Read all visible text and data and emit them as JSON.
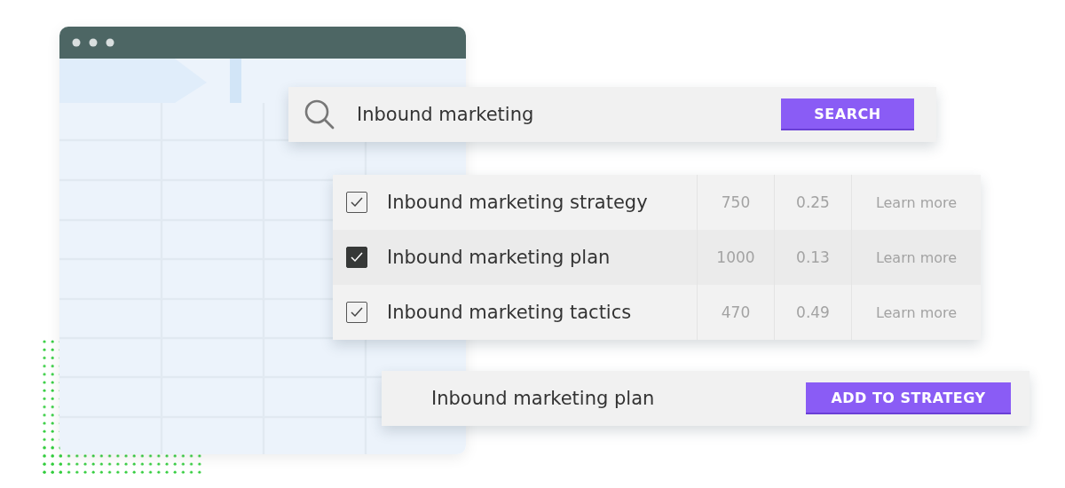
{
  "search": {
    "value": "Inbound marketing",
    "button": "SEARCH"
  },
  "results": [
    {
      "keyword": "Inbound marketing strategy",
      "checked": true,
      "selected": false,
      "volume": "750",
      "score": "0.25",
      "link": "Learn more"
    },
    {
      "keyword": "Inbound marketing plan",
      "checked": true,
      "selected": true,
      "volume": "1000",
      "score": "0.13",
      "link": "Learn more"
    },
    {
      "keyword": "Inbound marketing tactics",
      "checked": true,
      "selected": false,
      "volume": "470",
      "score": "0.49",
      "link": "Learn more"
    }
  ],
  "add_bar": {
    "keyword": "Inbound marketing plan",
    "button": "ADD TO STRATEGY"
  }
}
